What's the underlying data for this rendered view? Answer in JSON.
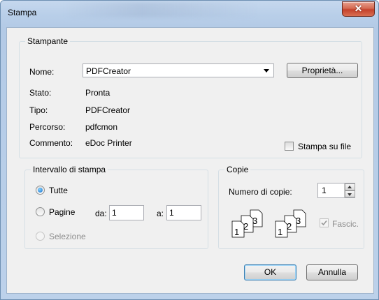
{
  "window": {
    "title": "Stampa"
  },
  "printer": {
    "group_title": "Stampante",
    "name_label": "Nome:",
    "name_value": "PDFCreator",
    "properties_button": "Proprietà...",
    "status_label": "Stato:",
    "status_value": "Pronta",
    "type_label": "Tipo:",
    "type_value": "PDFCreator",
    "path_label": "Percorso:",
    "path_value": "pdfcmon",
    "comment_label": "Commento:",
    "comment_value": "eDoc Printer",
    "print_to_file_label": "Stampa su file"
  },
  "range": {
    "group_title": "Intervallo di stampa",
    "all_label": "Tutte",
    "pages_label": "Pagine",
    "from_label": "da:",
    "from_value": "1",
    "to_label": "a:",
    "to_value": "1",
    "selection_label": "Selezione"
  },
  "copies": {
    "group_title": "Copie",
    "count_label": "Numero di copie:",
    "count_value": "1",
    "collate_label": "Fascic.",
    "collate_icon_pages": [
      "1",
      "2",
      "3"
    ]
  },
  "footer": {
    "ok_label": "OK",
    "cancel_label": "Annulla"
  }
}
